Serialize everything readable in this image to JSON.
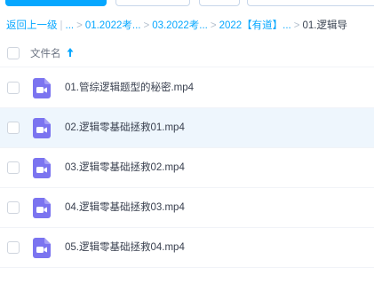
{
  "breadcrumb": {
    "back": "返回上一级",
    "ellipsis": "...",
    "items": [
      "01.2022考...",
      "03.2022考...",
      "2022【有道】...",
      "01.逻辑导"
    ],
    "separator": ">",
    "pipe": "|"
  },
  "header": {
    "name_column": "文件名"
  },
  "files": [
    {
      "name": "01.管综逻辑题型的秘密.mp4",
      "icon": "video-file-icon"
    },
    {
      "name": "02.逻辑零基础拯救01.mp4",
      "icon": "video-file-icon"
    },
    {
      "name": "03.逻辑零基础拯救02.mp4",
      "icon": "video-file-icon"
    },
    {
      "name": "04.逻辑零基础拯救03.mp4",
      "icon": "video-file-icon"
    },
    {
      "name": "05.逻辑零基础拯救04.mp4",
      "icon": "video-file-icon"
    }
  ],
  "colors": {
    "accent": "#06a7ff",
    "video_icon": "#7b74f0",
    "row_hover": "#eef6fd"
  }
}
